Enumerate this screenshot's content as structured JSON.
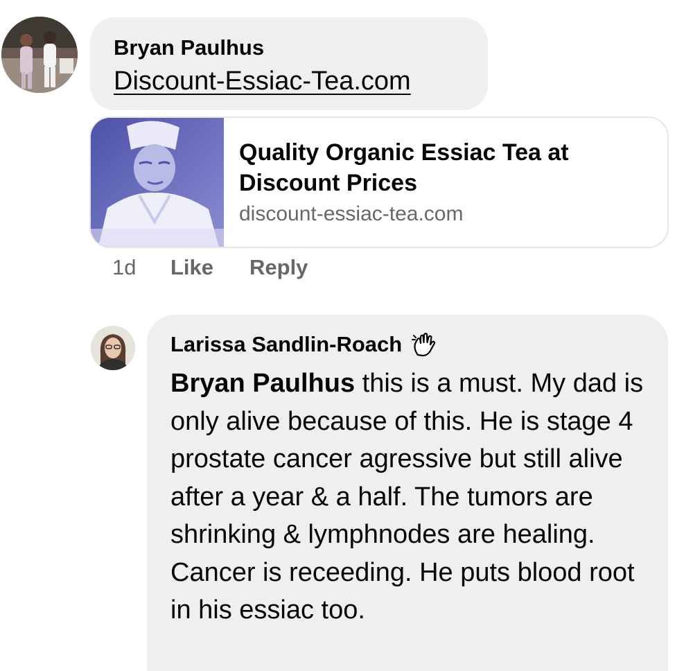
{
  "comment": {
    "author": "Bryan Paulhus",
    "link_text": "Discount-Essiac-Tea.com",
    "avatar_icon": "avatar-photo-two-people",
    "preview": {
      "title": "Quality Organic Essiac Tea at Discount Prices",
      "domain": "discount-essiac-tea.com",
      "thumbnail_icon": "nurse-portrait-photo"
    },
    "actions": {
      "time": "1d",
      "like": "Like",
      "reply": "Reply"
    }
  },
  "reply": {
    "author": "Larissa Sandlin-Roach",
    "badge_icon": "waving-hand-icon",
    "avatar_icon": "avatar-photo-woman",
    "mention": "Bryan Paulhus",
    "text": " this is a must. My dad is only alive because of this. He is stage 4 prostate cancer agressive but still alive after a year & a half. The tumors are shrinking & lymphnodes are healing. Cancer is receeding. He puts blood root in his essiac too."
  },
  "colors": {
    "bubble_bg": "#efefef",
    "secondary_text": "#65676b",
    "primary_text": "#050505",
    "thumbnail_tint": "#5b5fb3"
  }
}
